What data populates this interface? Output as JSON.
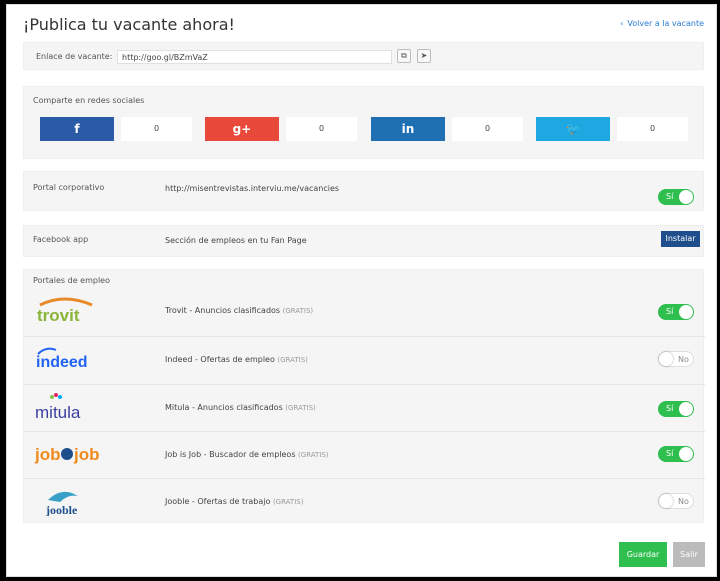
{
  "header": {
    "title": "¡Publica tu vacante ahora!",
    "back_label": "Volver a la vacante"
  },
  "link": {
    "label": "Enlace de vacante:",
    "value": "http://goo.gl/BZmVaZ",
    "copy_icon": "copy-icon",
    "send_icon": "send-icon"
  },
  "social": {
    "title": "Comparte en redes sociales",
    "networks": [
      {
        "name": "facebook",
        "glyph": "f",
        "count": "0",
        "color": "#2b5aa6"
      },
      {
        "name": "google-plus",
        "glyph": "g+",
        "count": "0",
        "color": "#e8493a"
      },
      {
        "name": "linkedin",
        "glyph": "in",
        "count": "0",
        "color": "#1f6fb3"
      },
      {
        "name": "twitter",
        "glyph": "🐦",
        "count": "0",
        "color": "#1da8e2"
      }
    ]
  },
  "corporate": {
    "label": "Portal corporativo",
    "url": "http://misentrevistas.interviu.me/vacancies",
    "toggle": "Sí"
  },
  "facebook_app": {
    "label": "Facebook app",
    "desc": "Sección de empleos en tu Fan Page",
    "button": "Instalar"
  },
  "portals": {
    "title": "Portales de empleo",
    "gratis": "(GRATIS)",
    "items": [
      {
        "logo": "trovit",
        "name": "Trovit - Anuncios clasificados",
        "toggle": "Sí",
        "on": true
      },
      {
        "logo": "indeed",
        "name": "Indeed - Ofertas de empleo",
        "toggle": "No",
        "on": false
      },
      {
        "logo": "mitula",
        "name": "Mitula - Anuncios clasificados",
        "toggle": "Sí",
        "on": true
      },
      {
        "logo": "jobisjob",
        "name": "Job is Job - Buscador de empleos",
        "toggle": "Sí",
        "on": true
      },
      {
        "logo": "jooble",
        "name": "Jooble - Ofertas de trabajo",
        "toggle": "No",
        "on": false
      }
    ]
  },
  "footer": {
    "save": "Guardar",
    "exit": "Salir"
  }
}
